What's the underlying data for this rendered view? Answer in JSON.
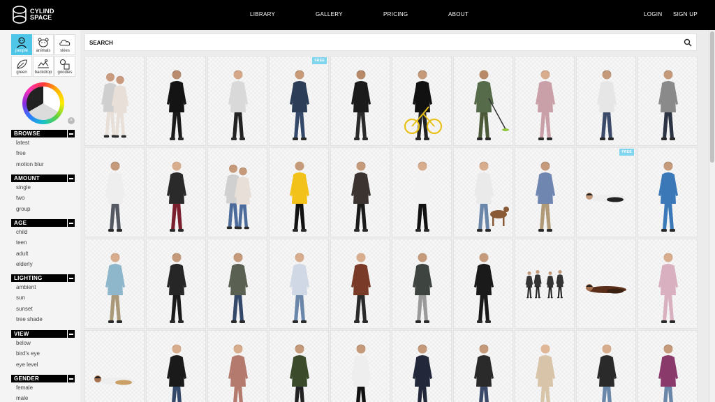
{
  "header": {
    "logo_line1": "CYLIND",
    "logo_line2": "SPACE",
    "nav": [
      "LIBRARY",
      "GALLERY",
      "PRICING",
      "ABOUT"
    ],
    "login": "LOGIN",
    "signup": "SIGN UP"
  },
  "categories": [
    {
      "label": "people",
      "icon": "people-icon",
      "active": true
    },
    {
      "label": "animals",
      "icon": "animals-icon",
      "active": false
    },
    {
      "label": "skies",
      "icon": "cloud-icon",
      "active": false
    },
    {
      "label": "green",
      "icon": "leaf-icon",
      "active": false
    },
    {
      "label": "backdrop",
      "icon": "backdrop-icon",
      "active": false
    },
    {
      "label": "goodies",
      "icon": "goodies-icon",
      "active": false
    }
  ],
  "sidebar": {
    "browse": {
      "title": "BROWSE",
      "items": [
        "latest",
        "free",
        "motion blur"
      ]
    },
    "amount": {
      "title": "AMOUNT",
      "items": [
        "single",
        "two",
        "group"
      ]
    },
    "age": {
      "title": "AGE",
      "items": [
        "child",
        "teen",
        "adult",
        "elderly"
      ]
    },
    "lighting": {
      "title": "LIGHTING",
      "items": [
        "ambient",
        "sun",
        "sunset",
        "tree shade"
      ]
    },
    "view": {
      "title": "VIEW",
      "items": [
        "below",
        "bird's eye",
        "eye level"
      ]
    },
    "gender": {
      "title": "GENDER",
      "items": [
        "female",
        "male"
      ]
    }
  },
  "search": {
    "placeholder": "SEARCH"
  },
  "badge": {
    "free": "FREE"
  },
  "colors": {
    "accent": "#4fc6e8",
    "header_bg": "#000000",
    "free_badge": "#7fd4ee"
  },
  "grid": {
    "tiles": [
      {
        "coat": "#cfcfcf",
        "pants": "#e8e0d8",
        "skin": "#c99a7e",
        "hair": "#6b4a2e",
        "kind": "pair",
        "free": false
      },
      {
        "coat": "#141414",
        "pants": "#1a1a1a",
        "skin": "#b98c70",
        "hair": "#222",
        "kind": "walk",
        "free": false
      },
      {
        "coat": "#d9d9d9",
        "pants": "#222222",
        "skin": "#d4a889",
        "hair": "#7a5a3c",
        "kind": "walk",
        "free": false
      },
      {
        "coat": "#2c3e57",
        "pants": "#34486a",
        "skin": "#c89a78",
        "hair": "#3b2a1e",
        "kind": "sit",
        "free": true
      },
      {
        "coat": "#1b1b1b",
        "pants": "#2a2a2a",
        "skin": "#b88a6a",
        "hair": "#111",
        "kind": "walk",
        "free": false
      },
      {
        "coat": "#111111",
        "pants": "#222",
        "skin": "#c49a7a",
        "hair": "#111",
        "kind": "bike",
        "free": false
      },
      {
        "coat": "#556b4a",
        "pants": "#4d5a3a",
        "skin": "#b88a6a",
        "hair": "#d6c44a",
        "kind": "trimmer",
        "free": false
      },
      {
        "coat": "#caa0a8",
        "pants": "#caa0a8",
        "skin": "#d8ad8e",
        "hair": "#6a3d28",
        "kind": "dress",
        "free": false
      },
      {
        "coat": "#e6e6e6",
        "pants": "#3a4a68",
        "skin": "#c49a7a",
        "hair": "#222",
        "kind": "walk",
        "free": false
      },
      {
        "coat": "#8a8a8a",
        "pants": "#2c3444",
        "skin": "#c49a7a",
        "hair": "#444",
        "kind": "walk",
        "free": false
      },
      {
        "coat": "#eeeeee",
        "pants": "#555a62",
        "skin": "#c49a7a",
        "hair": "#333",
        "kind": "sit",
        "free": false
      },
      {
        "coat": "#2a2a2a",
        "pants": "#7a1f2e",
        "skin": "#d8ad8e",
        "hair": "#8a6a4a",
        "kind": "walk",
        "free": false
      },
      {
        "coat": "#d0d0d0",
        "pants": "#4c6a9a",
        "skin": "#c49a7a",
        "hair": "#5a3a22",
        "kind": "pair",
        "free": false
      },
      {
        "coat": "#f2c21a",
        "pants": "#111",
        "skin": "#c49a7a",
        "hair": "#f2c21a",
        "kind": "walk",
        "free": false
      },
      {
        "coat": "#3a3330",
        "pants": "#1a1a1a",
        "skin": "#c49a7a",
        "hair": "#4a2e1c",
        "kind": "walk",
        "free": false
      },
      {
        "coat": "#f2f2f2",
        "pants": "#111",
        "skin": "#d8ad8e",
        "hair": "#333",
        "kind": "walk",
        "free": false
      },
      {
        "coat": "#eaeaea",
        "pants": "#6a86a8",
        "skin": "#d8ad8e",
        "hair": "#333",
        "kind": "dog",
        "free": false
      },
      {
        "coat": "#6f86b0",
        "pants": "#b09a78",
        "skin": "#c49a7a",
        "hair": "#333",
        "kind": "walk",
        "free": false
      },
      {
        "coat": "#eeeeee",
        "pants": "#222",
        "skin": "#c49a7a",
        "hair": "#222",
        "kind": "lying",
        "free": true
      },
      {
        "coat": "#3b78b8",
        "pants": "#3b78b8",
        "skin": "#c49a7a",
        "hair": "#222",
        "kind": "walk",
        "free": false
      },
      {
        "coat": "#8fb7cc",
        "pants": "#aa9a7a",
        "skin": "#d8ad8e",
        "hair": "#8a6a4a",
        "kind": "walk",
        "free": false
      },
      {
        "coat": "#262626",
        "pants": "#1a1a1a",
        "skin": "#c49a7a",
        "hair": "#222",
        "kind": "walk",
        "free": false
      },
      {
        "coat": "#5a6052",
        "pants": "#34486a",
        "skin": "#c49a7a",
        "hair": "#5a4030",
        "kind": "sit",
        "free": false
      },
      {
        "coat": "#cfd8e4",
        "pants": "#6a86a8",
        "skin": "#d8ad8e",
        "hair": "#6a4a2e",
        "kind": "walk",
        "free": false
      },
      {
        "coat": "#7a3a28",
        "pants": "#2a2a2a",
        "skin": "#d8ad8e",
        "hair": "#c9a066",
        "kind": "walk",
        "free": false
      },
      {
        "coat": "#3e4440",
        "pants": "#9a9a9a",
        "skin": "#c49a7a",
        "hair": "#9a9a9a",
        "kind": "walk",
        "free": false
      },
      {
        "coat": "#1a1a1a",
        "pants": "#1a1a1a",
        "skin": "#c49a7a",
        "hair": "#aaaaaa",
        "kind": "walk",
        "free": false
      },
      {
        "coat": "#333333",
        "pants": "#222",
        "skin": "#c49a7a",
        "hair": "#222",
        "kind": "group",
        "free": false
      },
      {
        "coat": "#5a2e18",
        "pants": "#3a2010",
        "skin": "#a8724e",
        "hair": "#222",
        "kind": "lying",
        "free": false
      },
      {
        "coat": "#d8b0c0",
        "pants": "#d8b0c0",
        "skin": "#d8ad8e",
        "hair": "#8a5a3a",
        "kind": "dress",
        "free": false
      },
      {
        "coat": "#eeeeee",
        "pants": "#c9a066",
        "skin": "#a8724e",
        "hair": "#222",
        "kind": "lying",
        "free": false
      },
      {
        "coat": "#1a1a1a",
        "pants": "#34486a",
        "skin": "#d8ad8e",
        "hair": "#6a4a2e",
        "kind": "walk",
        "free": false
      },
      {
        "coat": "#b57a6e",
        "pants": "#b57a6e",
        "skin": "#d8ad8e",
        "hair": "#3a2a20",
        "kind": "sit",
        "free": false
      },
      {
        "coat": "#3a4a2a",
        "pants": "#222",
        "skin": "#c49a7a",
        "hair": "#111",
        "kind": "walk",
        "free": false
      },
      {
        "coat": "#eeeeee",
        "pants": "#111",
        "skin": "#c49a7a",
        "hair": "#222",
        "kind": "walk",
        "free": false
      },
      {
        "coat": "#22283a",
        "pants": "#22283a",
        "skin": "#c49a7a",
        "hair": "#22283a",
        "kind": "walk",
        "free": false
      },
      {
        "coat": "#2a2a2a",
        "pants": "#3a4a68",
        "skin": "#c49a7a",
        "hair": "#222",
        "kind": "walk",
        "free": false
      },
      {
        "coat": "#d8c4a8",
        "pants": "#d8c4a8",
        "skin": "#e0b898",
        "hair": "#d0a860",
        "kind": "dress",
        "free": false
      },
      {
        "coat": "#2a2a2a",
        "pants": "#6a86a8",
        "skin": "#d8ad8e",
        "hair": "#8a6a4a",
        "kind": "walk",
        "free": false
      },
      {
        "coat": "#8a3a6a",
        "pants": "#6a86a8",
        "skin": "#c49a7a",
        "hair": "#333",
        "kind": "walk",
        "free": false
      }
    ]
  }
}
